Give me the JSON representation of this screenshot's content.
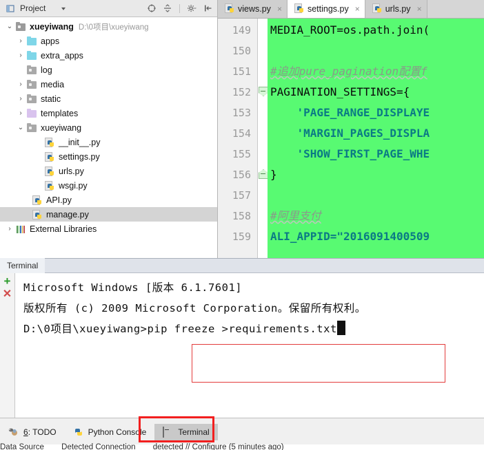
{
  "project_panel": {
    "title": "Project",
    "caret": "▾",
    "tools": [
      {
        "name": "locate-icon",
        "glyph": "⊕"
      },
      {
        "name": "collapse-all-icon",
        "glyph": "÷"
      },
      {
        "name": "settings-gear-icon",
        "glyph": "✲"
      },
      {
        "name": "hide-panel-icon",
        "glyph": "⇤"
      }
    ],
    "tree": [
      {
        "label": "xueyiwang",
        "path": "D:\\0项目\\xueyiwang",
        "arrow": "⌄",
        "icon": "folder-dark",
        "indent": 0,
        "bold": true,
        "selected": false
      },
      {
        "label": "apps",
        "path": "",
        "arrow": "›",
        "icon": "folder-cyan",
        "indent": 1,
        "bold": false,
        "selected": false
      },
      {
        "label": "extra_apps",
        "path": "",
        "arrow": "›",
        "icon": "folder-cyan",
        "indent": 1,
        "bold": false,
        "selected": false
      },
      {
        "label": "log",
        "path": "",
        "arrow": "",
        "icon": "folder-gray",
        "indent": 1,
        "bold": false,
        "selected": false
      },
      {
        "label": "media",
        "path": "",
        "arrow": "›",
        "icon": "folder-gray",
        "indent": 1,
        "bold": false,
        "selected": false
      },
      {
        "label": "static",
        "path": "",
        "arrow": "›",
        "icon": "folder-gray",
        "indent": 1,
        "bold": false,
        "selected": false
      },
      {
        "label": "templates",
        "path": "",
        "arrow": "›",
        "icon": "folder-purple",
        "indent": 1,
        "bold": false,
        "selected": false
      },
      {
        "label": "xueyiwang",
        "path": "",
        "arrow": "⌄",
        "icon": "folder-gray",
        "indent": 1,
        "bold": false,
        "selected": false
      },
      {
        "label": "__init__.py",
        "path": "",
        "arrow": "",
        "icon": "python-file",
        "indent": 2,
        "bold": false,
        "selected": false
      },
      {
        "label": "settings.py",
        "path": "",
        "arrow": "",
        "icon": "python-file",
        "indent": 2,
        "bold": false,
        "selected": false
      },
      {
        "label": "urls.py",
        "path": "",
        "arrow": "",
        "icon": "python-file",
        "indent": 2,
        "bold": false,
        "selected": false
      },
      {
        "label": "wsgi.py",
        "path": "",
        "arrow": "",
        "icon": "python-file",
        "indent": 2,
        "bold": false,
        "selected": false
      },
      {
        "label": "API.py",
        "path": "",
        "arrow": "",
        "icon": "python-file",
        "indent": 1.5,
        "bold": false,
        "selected": false
      },
      {
        "label": "manage.py",
        "path": "",
        "arrow": "",
        "icon": "python-file",
        "indent": 1.5,
        "bold": false,
        "selected": true
      },
      {
        "label": "External Libraries",
        "path": "",
        "arrow": "›",
        "icon": "library",
        "indent": 0,
        "bold": false,
        "selected": false
      }
    ]
  },
  "editor": {
    "tabs": [
      {
        "label": "views.py",
        "active": false,
        "close": "×"
      },
      {
        "label": "settings.py",
        "active": true,
        "close": "×"
      },
      {
        "label": "urls.py",
        "active": false,
        "close": "×"
      }
    ],
    "selection_color": "#58fa72",
    "lines": [
      {
        "num": "149",
        "text": "MEDIA_ROOT=os.path.join(",
        "kind": "plain",
        "fold": ""
      },
      {
        "num": "150",
        "text": "",
        "kind": "plain",
        "fold": ""
      },
      {
        "num": "151",
        "text": "#追加pure_pagination配置f",
        "kind": "comment",
        "fold": ""
      },
      {
        "num": "152",
        "text": "PAGINATION_SETTINGS={",
        "kind": "plain",
        "fold": "open-down"
      },
      {
        "num": "153",
        "text": "    'PAGE_RANGE_DISPLAYE",
        "kind": "string",
        "fold": ""
      },
      {
        "num": "154",
        "text": "    'MARGIN_PAGES_DISPLA",
        "kind": "string",
        "fold": ""
      },
      {
        "num": "155",
        "text": "    'SHOW_FIRST_PAGE_WHE",
        "kind": "string",
        "fold": ""
      },
      {
        "num": "156",
        "text": "}",
        "kind": "plain",
        "fold": "open-up"
      },
      {
        "num": "157",
        "text": "",
        "kind": "plain",
        "fold": ""
      },
      {
        "num": "158",
        "text": "#阿里支付",
        "kind": "comment",
        "fold": ""
      },
      {
        "num": "159",
        "text": "ALI_APPID=\"2016091400509",
        "kind": "string",
        "fold": ""
      }
    ]
  },
  "terminal": {
    "header_tab": "Terminal",
    "add_button": "+",
    "close_button": "✕",
    "lines": [
      "Microsoft Windows [版本 6.1.7601]",
      "版权所有 (c) 2009 Microsoft Corporation。保留所有权利。",
      "",
      "D:\\0项目\\xueyiwang>pip freeze >requirements.txt"
    ],
    "prompt": "D:\\0项目\\xueyiwang>",
    "command": "pip freeze >requirements.txt",
    "highlight_color": "#e33b3b"
  },
  "statusbar": {
    "items": [
      {
        "label": "6: TODO",
        "icon": "todo-icon",
        "active": false,
        "mnemonic": "6"
      },
      {
        "label": "Python Console",
        "icon": "python-console-icon",
        "active": false,
        "mnemonic": ""
      },
      {
        "label": "Terminal",
        "icon": "terminal-icon",
        "active": true,
        "mnemonic": ""
      }
    ],
    "bottom_hints": [
      "Data Source",
      "Detected Connection",
      "detected // Configure (5 minutes ago)"
    ],
    "highlight_color": "#f21f1f"
  }
}
